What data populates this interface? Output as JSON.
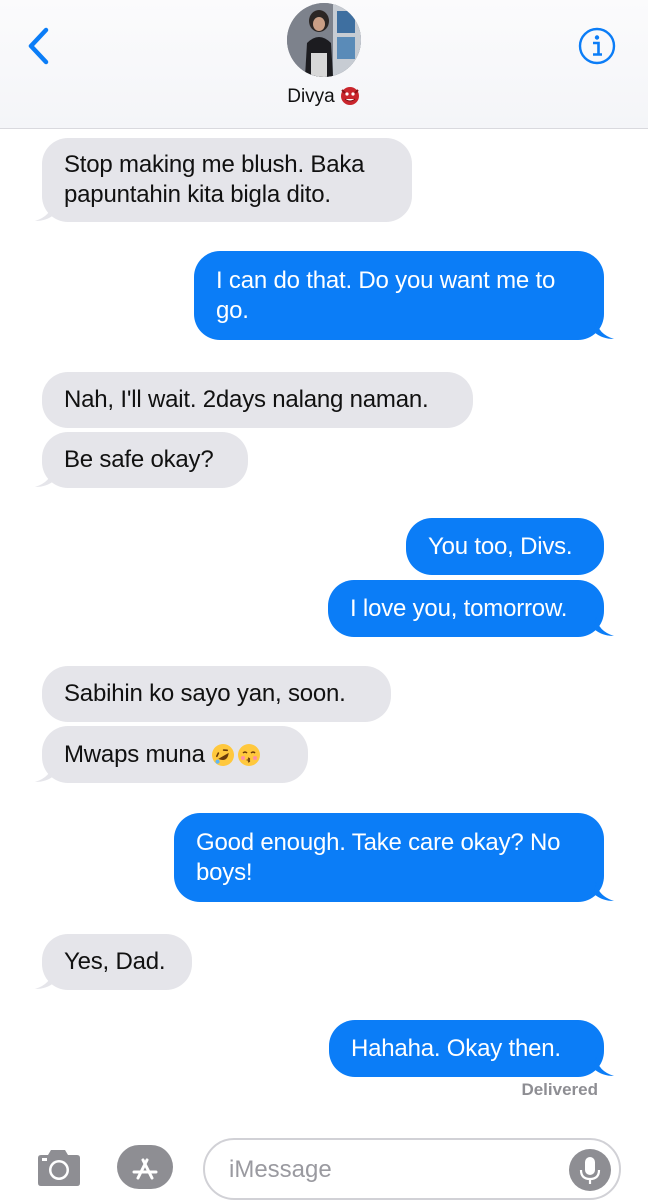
{
  "header": {
    "contact_name": "Divya",
    "contact_emoji": "ogre-face",
    "back_icon": "chevron-left-icon",
    "info_icon": "info-icon"
  },
  "colors": {
    "accent": "#0b7df7",
    "incoming_bubble": "#e5e5ea",
    "outgoing_text": "#ffffff",
    "delivered": "#8e8e93"
  },
  "messages": [
    {
      "from": "them",
      "lines": [
        "Stop making me blush. Baka",
        "papuntahin kita bigla dito."
      ]
    },
    {
      "from": "me",
      "lines": [
        "I can do that. Do you want me to",
        "go."
      ]
    },
    {
      "from": "them",
      "lines": [
        "Nah, I'll wait. 2days nalang naman."
      ]
    },
    {
      "from": "them",
      "lines": [
        "Be safe okay?"
      ]
    },
    {
      "from": "me",
      "lines": [
        "You too, Divs."
      ]
    },
    {
      "from": "me",
      "lines": [
        "I love you, tomorrow."
      ]
    },
    {
      "from": "them",
      "lines": [
        "Sabihin ko sayo yan, soon."
      ]
    },
    {
      "from": "them",
      "lines": [
        "Mwaps muna"
      ],
      "emojis": [
        "rolling-on-floor-laughing",
        "kissing-face-closed-eyes"
      ]
    },
    {
      "from": "me",
      "lines": [
        "Good enough. Take care okay? No",
        "boys!"
      ]
    },
    {
      "from": "them",
      "lines": [
        "Yes, Dad."
      ]
    },
    {
      "from": "me",
      "lines": [
        "Hahaha. Okay then."
      ]
    }
  ],
  "status": {
    "delivered": "Delivered"
  },
  "input": {
    "placeholder": "iMessage",
    "value": ""
  },
  "toolbar": {
    "camera_icon": "camera-icon",
    "apps_icon": "app-store-icon",
    "mic_icon": "microphone-icon"
  }
}
